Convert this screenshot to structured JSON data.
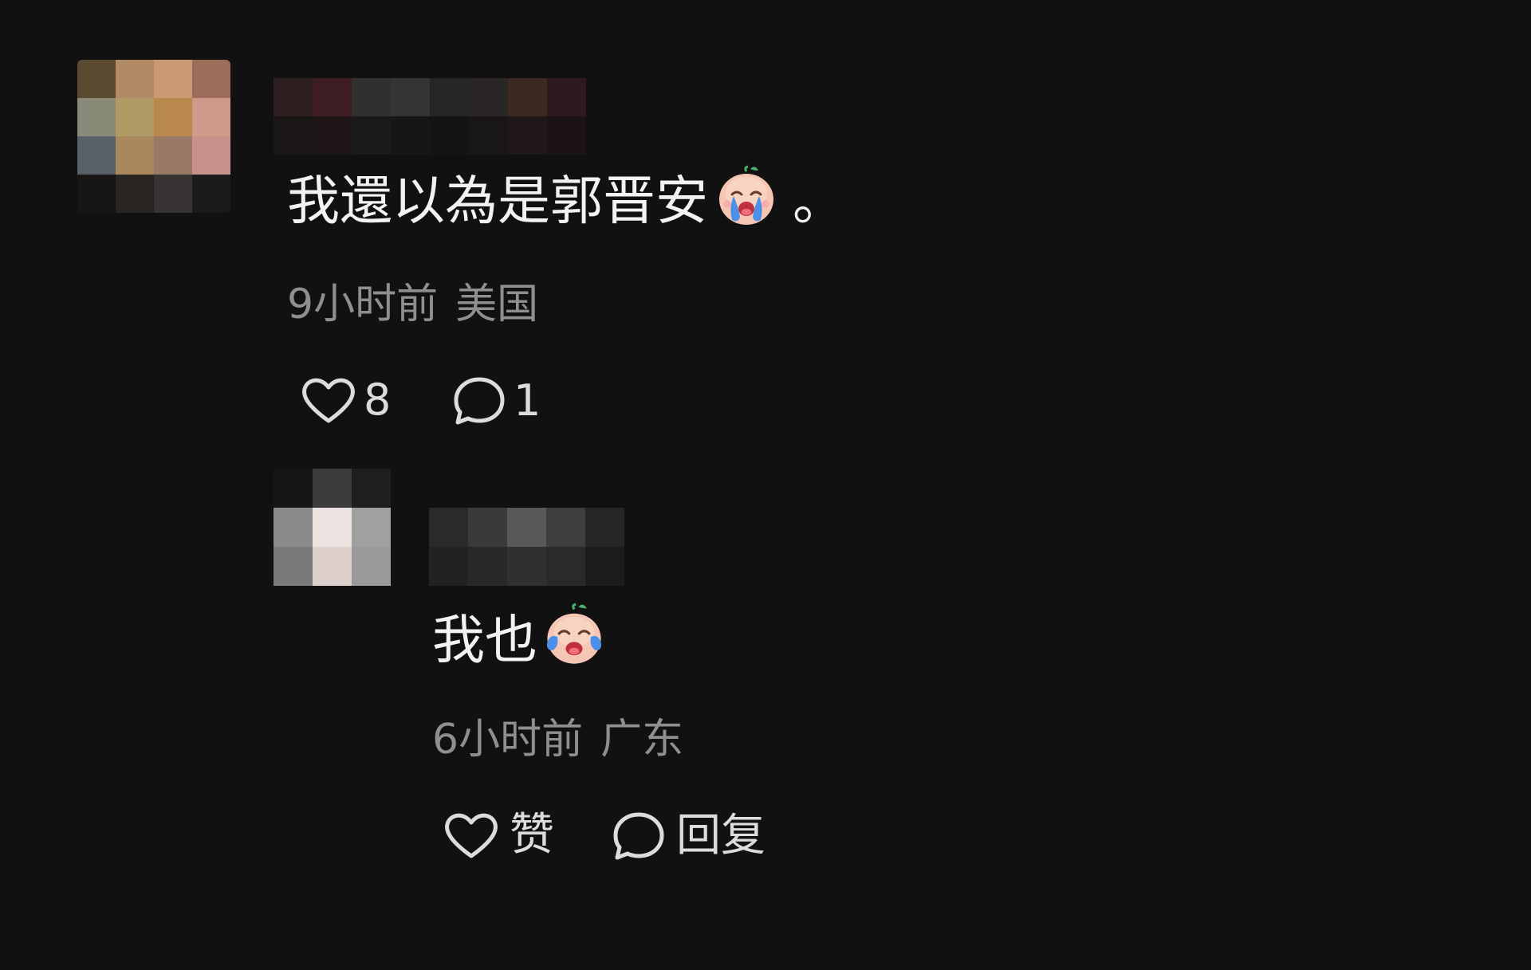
{
  "comment": {
    "text": "我還以為是郭晋安",
    "trailing": "。",
    "emoji": "crying-baby-emoji",
    "time": "9小时前",
    "location": "美国",
    "like_count": "8",
    "reply_count": "1",
    "avatar_pixels": [
      "#5a4a30",
      "#b08a62",
      "#c99a72",
      "#9c6e5a",
      "#8a8a78",
      "#b09a66",
      "#b8884c",
      "#d09a8a",
      "#5a6068",
      "#a8885c",
      "#9a7a66",
      "#c8928a",
      "#181614",
      "#282420",
      "#383232",
      "#1c1a1a"
    ],
    "name_pixels": [
      "#2e2020",
      "#3e1e22",
      "#303030",
      "#343434",
      "#262626",
      "#2a2626",
      "#3e2822",
      "#2e1a1e",
      "#1a1616",
      "#1e1616",
      "#1a1a1a",
      "#161616",
      "#141414",
      "#181616",
      "#201818",
      "#1c1414"
    ]
  },
  "reply": {
    "text": "我也",
    "emoji": "crying-baby-emoji",
    "time": "6小时前",
    "location": "广东",
    "like_label": "赞",
    "reply_label": "回复",
    "avatar_pixels": [
      "#161616",
      "#3c3c3c",
      "#1e1e1e",
      "#8a8a8a",
      "#ece2e0",
      "#a0a0a0",
      "#7a7a7a",
      "#ddd0cc",
      "#9a9a9a"
    ],
    "name_pixels": [
      "#2a2a2a",
      "#3a3a3a",
      "#585858",
      "#3e3e3e",
      "#262626",
      "#222222",
      "#282828",
      "#303030",
      "#2a2a2a",
      "#1c1c1c"
    ]
  },
  "colors": {
    "background": "#111111",
    "text": "#f2f2f2",
    "meta": "#8f8f8f",
    "icon": "#dcdcdc"
  }
}
